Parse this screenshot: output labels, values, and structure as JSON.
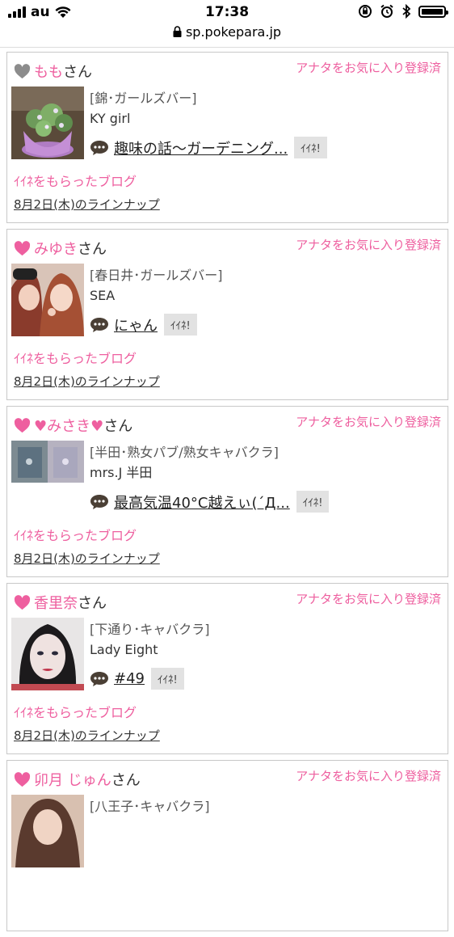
{
  "status": {
    "carrier": "au",
    "time": "17:38",
    "url": "sp.pokepara.jp"
  },
  "labels": {
    "san": "さん",
    "fav_registered": "アナタをお気に入り登録済",
    "iine": "ｲｲﾈ!",
    "got_iine_blog": "ｲｲﾈをもらったブログ",
    "lineup": "8月2日(木)のラインナップ"
  },
  "cards": [
    {
      "name": "もも",
      "shop": "[錦･ガールズバー]",
      "staff": "KY girl",
      "blog_title": "趣味の話〜ガーデニング...",
      "heart_color": "#8c8c8c"
    },
    {
      "name": "みゆき",
      "shop": "[春日井･ガールズバー]",
      "staff": "SEA",
      "blog_title": "にゃん",
      "heart_color": "#ee5f9f"
    },
    {
      "name": "♥みさき♥",
      "shop": "[半田･熟女パブ/熟女キャバクラ]",
      "staff": "mrs.J 半田",
      "blog_title": "最高気温40°C越えぃ(´Д...",
      "heart_color": "#ee5f9f"
    },
    {
      "name": "香里奈",
      "shop": "[下通り･キャバクラ]",
      "staff": "Lady Eight",
      "blog_title": "#49",
      "heart_color": "#ee5f9f"
    },
    {
      "name": "卯月 じゅん",
      "shop": "[八王子･キャバクラ]",
      "heart_color": "#ee5f9f"
    }
  ],
  "icons": {
    "heart": "heart-icon",
    "bubble": "speech-bubble-icon",
    "lock": "lock-icon"
  },
  "colors": {
    "accent_pink": "#ee5f9f",
    "gray_heart": "#8c8c8c"
  }
}
